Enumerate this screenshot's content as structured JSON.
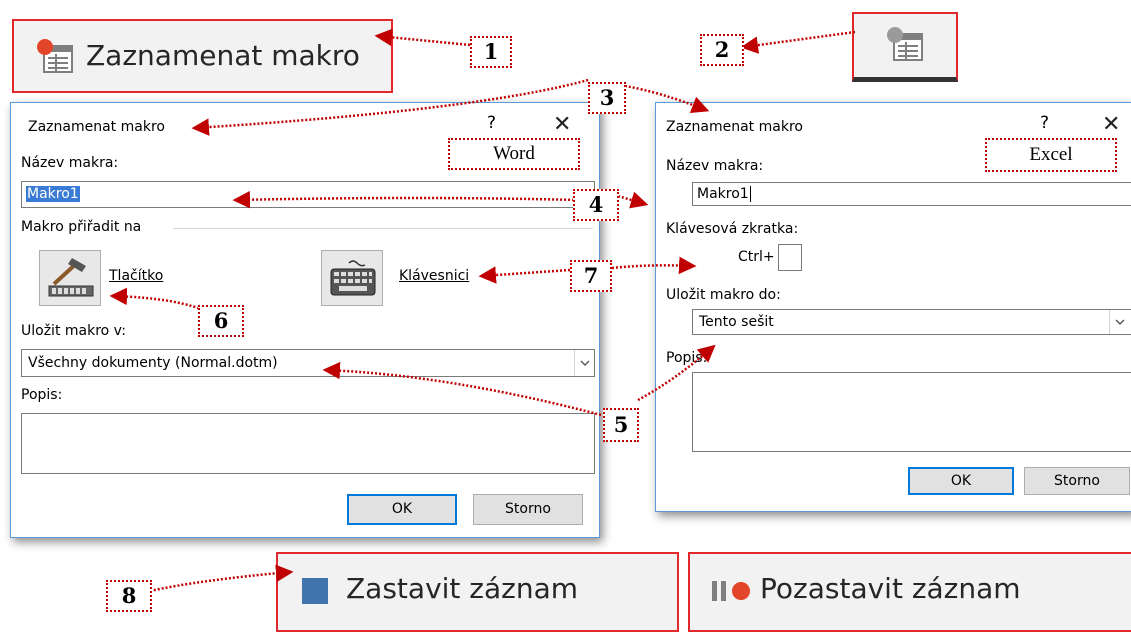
{
  "record_button": {
    "label": "Zaznamenat makro",
    "icon": "record-macro-icon"
  },
  "record_button_small": {
    "icon": "record-macro-icon"
  },
  "word_dialog": {
    "title": "Zaznamenat makro",
    "help": "?",
    "close": "✕",
    "name_label": "Název makra:",
    "name_value": "Makro1",
    "assign_label": "Makro přiřadit na",
    "button_label": "Tlačítko",
    "button_icon": "hammer-toolbar-icon",
    "keyboard_label": "Klávesnici",
    "keyboard_icon": "keyboard-icon",
    "store_label": "Uložit makro v:",
    "store_value": "Všechny dokumenty (Normal.dotm)",
    "desc_label": "Popis:",
    "ok": "OK",
    "cancel": "Storno"
  },
  "excel_dialog": {
    "title": "Zaznamenat makro",
    "help": "?",
    "close": "✕",
    "name_label": "Název makra:",
    "name_value": "Makro1",
    "shortcut_label": "Klávesová zkratka:",
    "ctrl_label": "Ctrl+",
    "ctrl_value": "",
    "store_label": "Uložit makro do:",
    "store_value": "Tento sešit",
    "desc_label": "Popis:",
    "ok": "OK",
    "cancel": "Storno"
  },
  "tags": {
    "word": "Word",
    "excel": "Excel"
  },
  "callouts": [
    "1",
    "2",
    "3",
    "4",
    "5",
    "6",
    "7",
    "8"
  ],
  "stop_button": {
    "label": "Zastavit záznam",
    "icon": "stop-icon"
  },
  "pause_button": {
    "label": "Pozastavit záznam",
    "icon": "pause-record-icon"
  },
  "colors": {
    "callout_red": "#c00000",
    "frame_red": "#e0282d",
    "dialog_border": "#5b9bd5",
    "stop_blue": "#3f74ad"
  }
}
